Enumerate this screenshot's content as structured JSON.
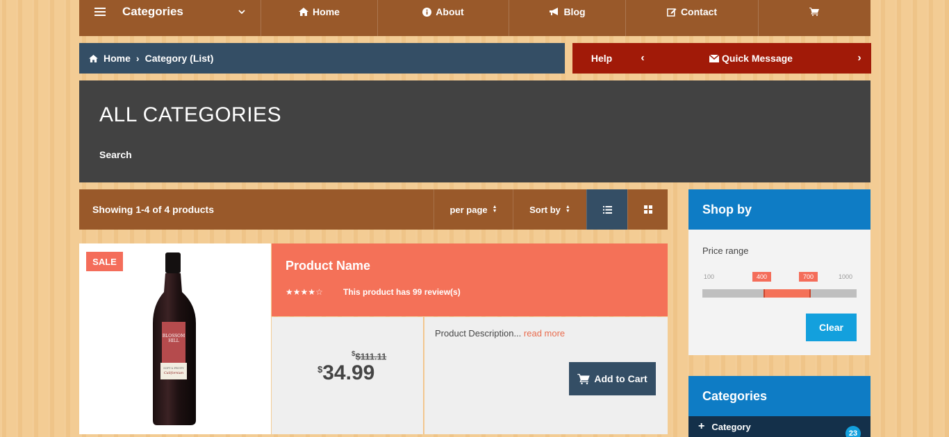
{
  "nav": {
    "categories": "Categories",
    "home": "Home",
    "about": "About",
    "blog": "Blog",
    "contact": "Contact"
  },
  "breadcrumb": {
    "home": "Home",
    "separator": "›",
    "current": "Category (List)"
  },
  "help_bar": {
    "help": "Help",
    "prev": "‹",
    "quick_message": "Quick Message",
    "next": "›"
  },
  "hero": {
    "title": "ALL CATEGORIES",
    "search": "Search"
  },
  "toolbar": {
    "showing": "Showing 1-4 of 4 products",
    "per_page": "per page",
    "sort_by": "Sort by"
  },
  "product": {
    "badge": "SALE",
    "name": "Product Name",
    "rating": 4,
    "rating_max": 5,
    "reviews": "This product has 99 review(s)",
    "old_price_currency": "$",
    "old_price": "$111.11",
    "currency": "$",
    "price": "34.99",
    "description": "Product Description...",
    "read_more": "read more",
    "add_to_cart": "Add to Cart",
    "wine_label": "BLOSSOM HILL"
  },
  "shop_by": {
    "title": "Shop by",
    "price_range_label": "Price range",
    "min": "100",
    "low": "400",
    "high": "700",
    "max": "1000",
    "clear": "Clear"
  },
  "categories": {
    "title": "Categories",
    "items": [
      {
        "label": "Category",
        "count": "23"
      }
    ]
  },
  "colors": {
    "brown": "#99592a",
    "navy": "#344e65",
    "red": "#a11a08",
    "coral": "#f47158",
    "blue": "#0e7cc5"
  }
}
